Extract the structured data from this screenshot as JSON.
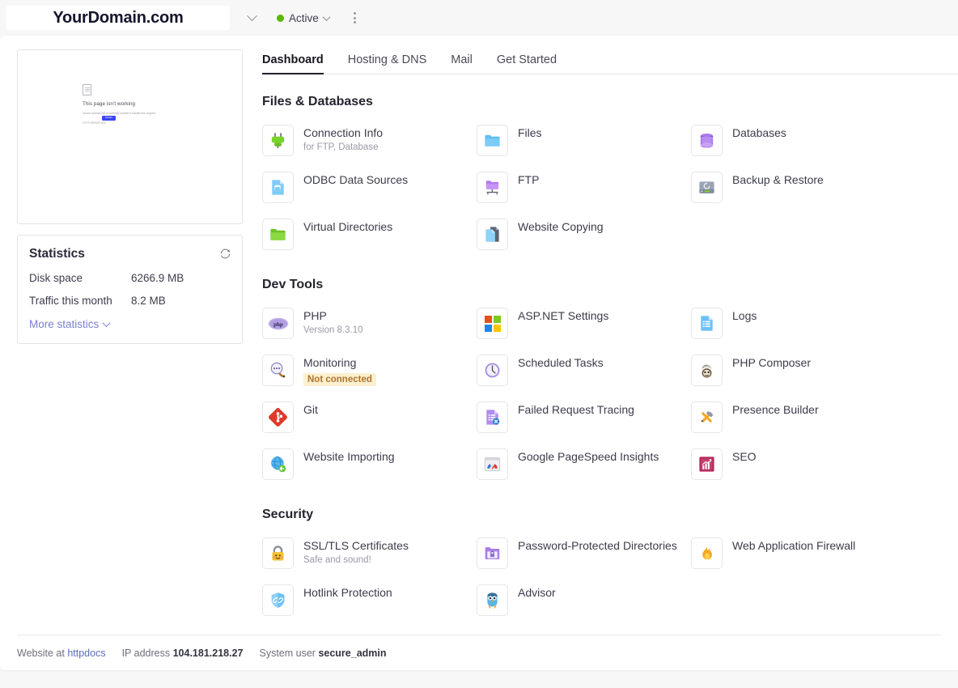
{
  "topbar": {
    "domain": "YourDomain.com",
    "domain_caret_icon": "chevron-down-icon",
    "status_label": "Active",
    "status_color": "#5cb800",
    "status_caret_icon": "chevron-down-icon",
    "more_icon": "kebab-menu-icon"
  },
  "preview": {
    "error_title": "This page isn't working",
    "error_line1": "secure-domain.net is currently unable to handle this request.",
    "error_line2": "HTTP ERROR 500",
    "error_button": "Reload",
    "doc_icon": "document-icon"
  },
  "statistics": {
    "title": "Statistics",
    "refresh_icon": "refresh-icon",
    "rows": [
      {
        "label": "Disk space",
        "value": "6266.9 MB"
      },
      {
        "label": "Traffic this month",
        "value": "8.2 MB"
      }
    ],
    "more_link": "More statistics",
    "more_icon": "chevron-down-icon"
  },
  "tabs": [
    {
      "label": "Dashboard",
      "active": true
    },
    {
      "label": "Hosting & DNS",
      "active": false
    },
    {
      "label": "Mail",
      "active": false
    },
    {
      "label": "Get Started",
      "active": false
    }
  ],
  "sections": [
    {
      "title": "Files & Databases",
      "tiles": [
        {
          "label": "Connection Info",
          "sub": "for FTP, Database",
          "icon": "plug-icon"
        },
        {
          "label": "Files",
          "sub": "",
          "icon": "folder-blue-icon"
        },
        {
          "label": "Databases",
          "sub": "",
          "icon": "database-icon"
        },
        {
          "label": "ODBC Data Sources",
          "sub": "",
          "icon": "odbc-document-icon"
        },
        {
          "label": "FTP",
          "sub": "",
          "icon": "ftp-folder-icon"
        },
        {
          "label": "Backup & Restore",
          "sub": "",
          "icon": "hard-drive-icon"
        },
        {
          "label": "Virtual Directories",
          "sub": "",
          "icon": "folder-green-icon"
        },
        {
          "label": "Website Copying",
          "sub": "",
          "icon": "copy-pages-icon"
        },
        {
          "label": "",
          "sub": "",
          "icon": ""
        }
      ]
    },
    {
      "title": "Dev Tools",
      "tiles": [
        {
          "label": "PHP",
          "sub": "Version 8.3.10",
          "icon": "php-icon"
        },
        {
          "label": "ASP.NET Settings",
          "sub": "",
          "icon": "windows-icon"
        },
        {
          "label": "Logs",
          "sub": "",
          "icon": "logs-document-icon"
        },
        {
          "label": "Monitoring",
          "badge": "Not connected",
          "icon": "magnifier-icon"
        },
        {
          "label": "Scheduled Tasks",
          "sub": "",
          "icon": "clock-icon"
        },
        {
          "label": "PHP Composer",
          "sub": "",
          "icon": "composer-icon"
        },
        {
          "label": "Git",
          "sub": "",
          "icon": "git-icon"
        },
        {
          "label": "Failed Request Tracing",
          "sub": "",
          "icon": "failed-request-icon"
        },
        {
          "label": "Presence Builder",
          "sub": "",
          "icon": "hammer-pencil-icon"
        },
        {
          "label": "Website Importing",
          "sub": "",
          "icon": "globe-import-icon"
        },
        {
          "label": "Google PageSpeed Insights",
          "sub": "",
          "icon": "speedometer-icon"
        },
        {
          "label": "SEO",
          "sub": "",
          "icon": "seo-chart-icon"
        }
      ]
    },
    {
      "title": "Security",
      "tiles": [
        {
          "label": "SSL/TLS Certificates",
          "sub": "Safe and sound!",
          "icon": "lock-icon"
        },
        {
          "label": "Password-Protected Directories",
          "sub": "",
          "icon": "locked-folder-icon"
        },
        {
          "label": "Web Application Firewall",
          "sub": "",
          "icon": "flame-icon"
        },
        {
          "label": "Hotlink Protection",
          "sub": "",
          "icon": "shield-link-icon"
        },
        {
          "label": "Advisor",
          "sub": "",
          "icon": "owl-icon"
        },
        {
          "label": "",
          "sub": "",
          "icon": ""
        }
      ]
    }
  ],
  "footer": {
    "website_prefix": "Website at",
    "website_value": "httpdocs",
    "ip_prefix": "IP address",
    "ip_value": "104.181.218.27",
    "user_prefix": "System user",
    "user_value": "secure_admin"
  }
}
